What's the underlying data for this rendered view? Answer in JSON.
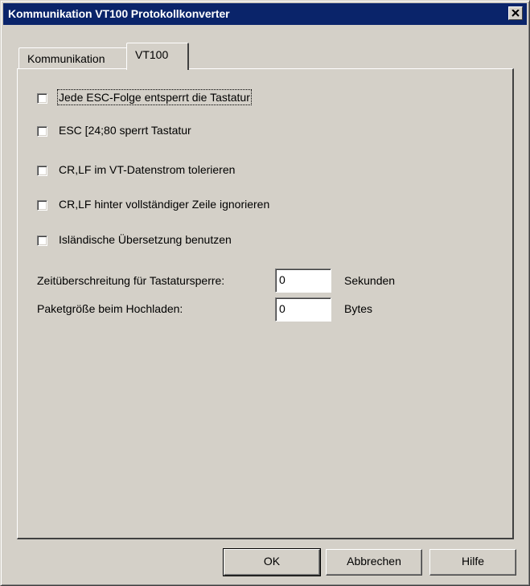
{
  "window": {
    "title": "Kommunikation VT100 Protokollkonverter",
    "close_symbol": "×"
  },
  "tabs": [
    {
      "label": "Kommunikation",
      "active": false
    },
    {
      "label": "VT100",
      "active": true
    }
  ],
  "options": [
    {
      "label": "Jede ESC-Folge entsperrt die Tastatur",
      "checked": false
    },
    {
      "label": "ESC [24;80 sperrt Tastatur",
      "checked": false
    },
    {
      "label": "CR,LF im VT-Datenstrom tolerieren",
      "checked": false
    },
    {
      "label": "CR,LF hinter vollständiger Zeile ignorieren",
      "checked": false
    },
    {
      "label": "Isländische Übersetzung benutzen",
      "checked": false
    }
  ],
  "fields": {
    "timeout": {
      "label": "Zeitüberschreitung für Tastatursperre:",
      "value": "0",
      "unit": "Sekunden"
    },
    "packet": {
      "label": "Paketgröße beim Hochladen:",
      "value": "0",
      "unit": "Bytes"
    }
  },
  "buttons": {
    "ok": "OK",
    "cancel": "Abbrechen",
    "help": "Hilfe"
  },
  "colors": {
    "titlebar": "#0a246a",
    "face": "#d4d0c8"
  }
}
